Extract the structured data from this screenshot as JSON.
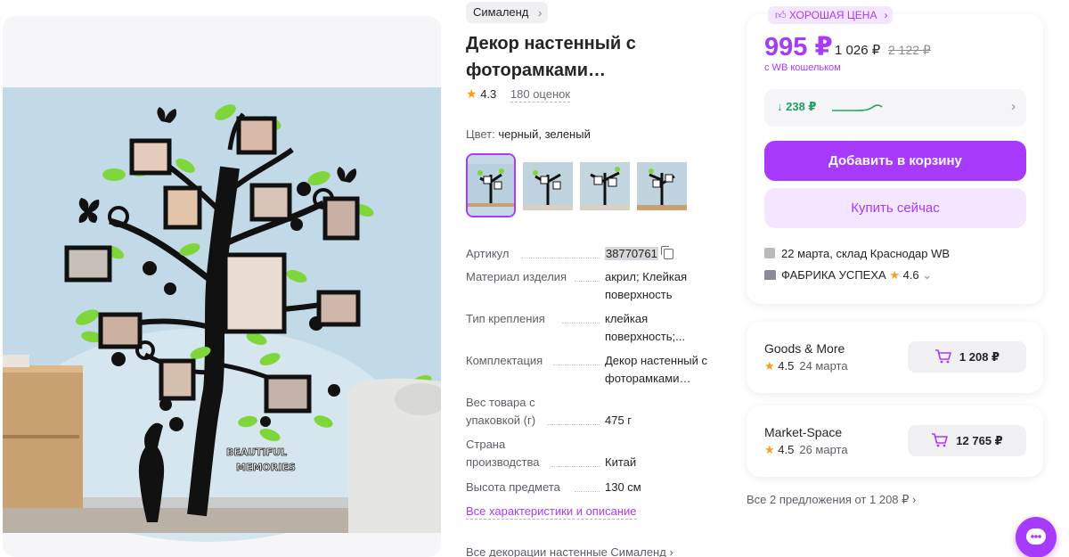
{
  "product": {
    "brand": "Сималенд",
    "title_line1": "Декор настенный с",
    "title_line2": "фоторамками…",
    "rating": "4.3",
    "reviews": "180 оценок",
    "color_label": "Цвет:",
    "color_value": "черный, зеленый",
    "image_text_line1": "BEAUTIFUL",
    "image_text_line2": "MEMORIES",
    "specs": [
      {
        "key": "Артикул",
        "value": "38770761"
      },
      {
        "key": "Материал изделия",
        "value": "акрил; Клейкая поверхность"
      },
      {
        "key": "Тип крепления",
        "value": "клейкая поверхность;..."
      },
      {
        "key": "Комплектация",
        "value": "Декор настенный с фоторамками…"
      },
      {
        "key": "Вес товара с упаковкой (г)",
        "value": "475 г"
      },
      {
        "key": "Страна производства",
        "value": "Китай"
      },
      {
        "key": "Высота предмета",
        "value": "130 см"
      }
    ],
    "all_characteristics": "Все характеристики и описание",
    "all_decorations": "Все декорации настенные Сималенд"
  },
  "pricing": {
    "badge": "ХОРОШАЯ ЦЕНА",
    "price": "995 ₽",
    "card_price": "1 026 ₽",
    "old_price": "2 122 ₽",
    "wallet_note": "с WB кошельком",
    "price_drop": "↓ 238 ₽",
    "add_to_cart": "Добавить в корзину",
    "buy_now": "Купить сейчас",
    "delivery_date": "22 марта",
    "delivery_rest": ", склад Краснодар WB",
    "seller_name": "ФАБРИКА УСПЕХА",
    "seller_rating": "4.6"
  },
  "offers": [
    {
      "seller": "Goods & More",
      "rating": "4.5",
      "date": "24 марта",
      "price": "1 208 ₽"
    },
    {
      "seller": "Market-Space",
      "rating": "4.5",
      "date": "26 марта",
      "price": "12 765 ₽"
    }
  ],
  "all_offers": "Все 2 предложения от 1 208 ₽",
  "colors": {
    "accent": "#a73afd",
    "accent_light": "#f4e6ff",
    "green": "#1da160",
    "star": "#ff9a1a"
  }
}
